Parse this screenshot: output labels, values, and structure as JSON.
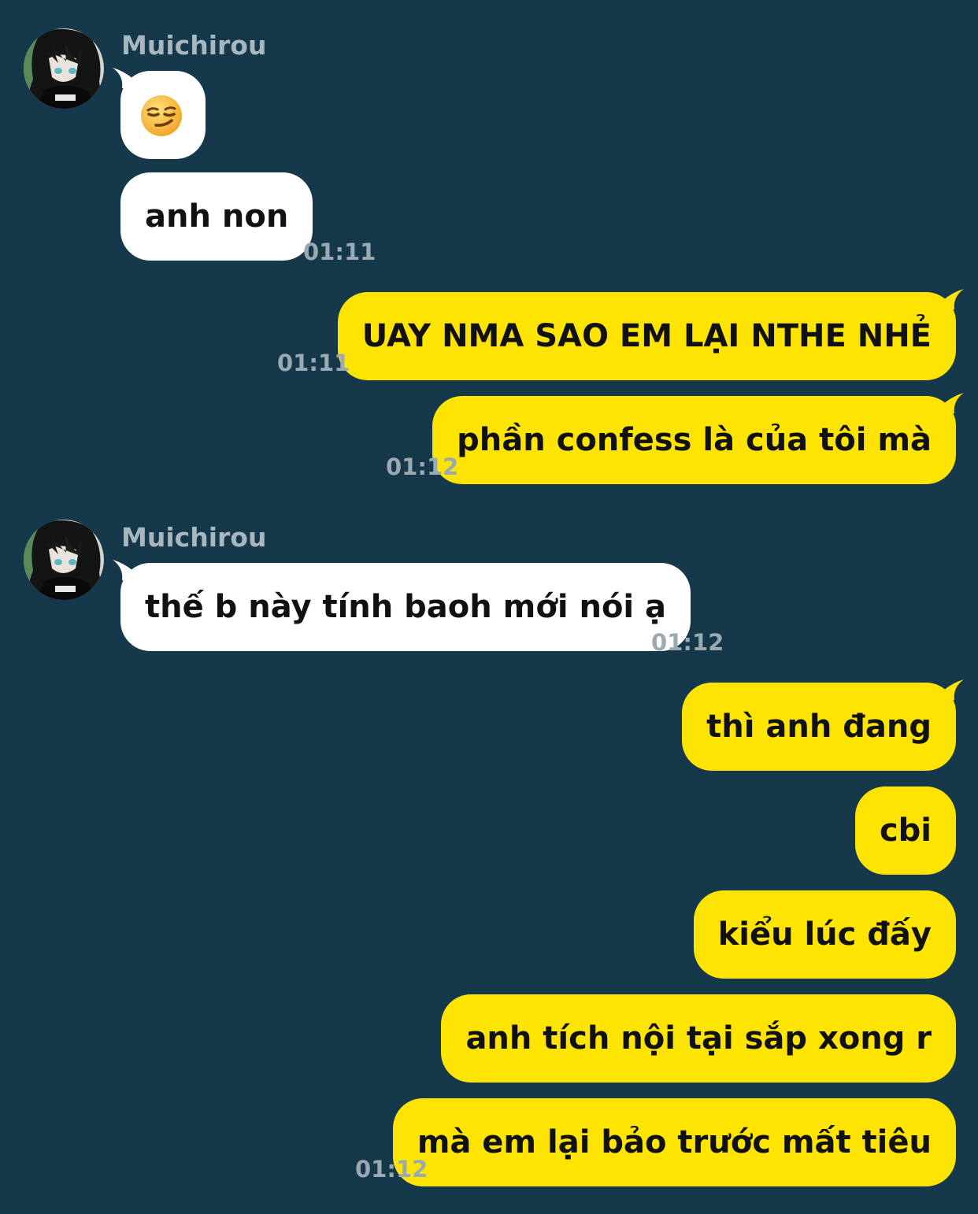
{
  "colors": {
    "background": "#15384b",
    "incoming_bubble": "#ffffff",
    "outgoing_bubble": "#fde402",
    "timestamp": "#9aa9b2",
    "sender_name": "#a8b6bf"
  },
  "groups": [
    {
      "sender": "Muichirou",
      "messages": [
        {
          "type": "emoji",
          "icon": "smirking-face-emoji"
        },
        {
          "text": "anh non"
        }
      ],
      "time": "01:11"
    },
    {
      "messages": [
        {
          "text": "UAY NMA SAO EM LẠI NTHE NHẺ"
        }
      ],
      "time": "01:11"
    },
    {
      "messages": [
        {
          "text": "phần confess là của tôi mà"
        }
      ],
      "time": "01:12"
    },
    {
      "sender": "Muichirou",
      "messages": [
        {
          "text": "thế b này tính baoh mới nói ạ"
        }
      ],
      "time": "01:12"
    },
    {
      "messages": [
        {
          "text": "thì anh đang"
        },
        {
          "text": "cbi"
        },
        {
          "text": "kiểu lúc đấy"
        },
        {
          "text": "anh tích nội tại sắp xong r"
        },
        {
          "text": "mà em lại bảo trước mất tiêu"
        }
      ],
      "time": "01:12"
    }
  ]
}
